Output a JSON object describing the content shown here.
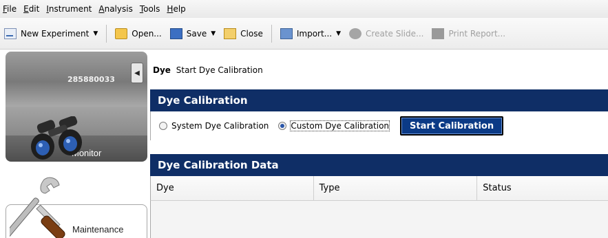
{
  "menubar": {
    "items": [
      {
        "first": "F",
        "rest": "ile"
      },
      {
        "first": "E",
        "rest": "dit"
      },
      {
        "first": "I",
        "rest": "nstrument"
      },
      {
        "first": "A",
        "rest": "nalysis"
      },
      {
        "first": "T",
        "rest": "ools"
      },
      {
        "first": "H",
        "rest": "elp"
      }
    ]
  },
  "toolbar": {
    "new_experiment": "New Experiment",
    "open": "Open...",
    "save": "Save",
    "close": "Close",
    "import": "Import...",
    "create_slide": "Create Slide...",
    "print_report": "Print Report..."
  },
  "leftnav": {
    "instrument_id": "285880033",
    "monitor_label": "Monitor",
    "maintenance_label": "Maintenance"
  },
  "breadcrumb": {
    "section": "Dye",
    "page": "Start Dye Calibration"
  },
  "calibration_panel": {
    "title": "Dye Calibration",
    "option_system": "System Dye Calibration",
    "option_custom": "Custom Dye Calibration",
    "selected": "custom",
    "start_button": "Start Calibration"
  },
  "data_panel": {
    "title": "Dye Calibration Data",
    "columns": [
      "Dye",
      "Type",
      "Status"
    ]
  }
}
